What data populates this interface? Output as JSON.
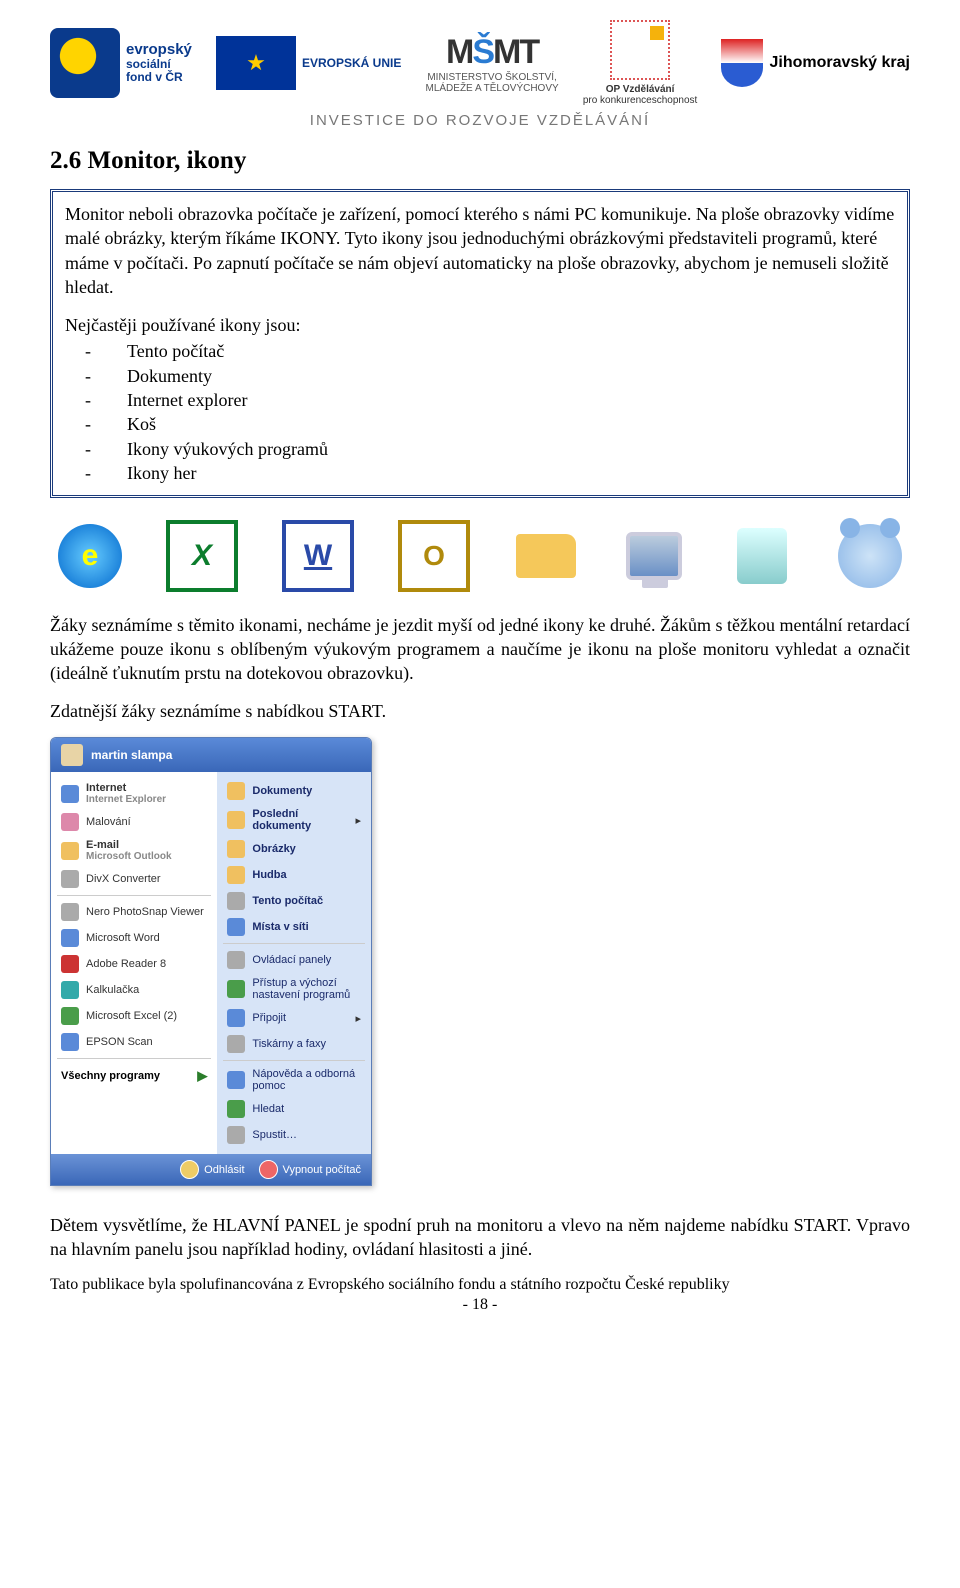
{
  "header": {
    "esf_line1": "evropský",
    "esf_line2": "sociální",
    "esf_line3": "fond v ČR",
    "eu_label": "EVROPSKÁ UNIE",
    "msmt_line1": "MINISTERSTVO ŠKOLSTVÍ,",
    "msmt_line2": "MLÁDEŽE A TĚLOVÝCHOVY",
    "opvz_line1": "OP Vzdělávání",
    "opvz_line2": "pro konkurenceschopnost",
    "jmk": "Jihomoravský kraj",
    "invest": "INVESTICE DO ROZVOJE VZDĚLÁVÁNÍ"
  },
  "title": "2.6 Monitor, ikony",
  "box": {
    "p1": "Monitor neboli obrazovka počítače je zařízení, pomocí kterého s námi PC komunikuje. Na ploše obrazovky vidíme malé obrázky, kterým říkáme IKONY. Tyto ikony jsou jednoduchými obrázkovými představiteli programů, které máme v počítači. Po zapnutí počítače se nám objeví automaticky na ploše obrazovky, abychom je nemuseli složitě hledat.",
    "list_intro": "Nejčastěji používané ikony jsou:",
    "items": [
      "Tento počítač",
      "Dokumenty",
      "Internet explorer",
      "Koš",
      "Ikony výukových programů",
      "Ikony her"
    ]
  },
  "icons_row": {
    "ie": "e",
    "excel": "X",
    "word": "W",
    "outlook": "O"
  },
  "body1": "Žáky seznámíme s těmito ikonami, necháme je jezdit myší od jedné ikony ke druhé. Žákům s těžkou mentální retardací ukážeme pouze ikonu s oblíbeným výukovým programem a naučíme je ikonu na ploše monitoru vyhledat a označit (ideálně ťuknutím prstu na dotekovou obrazovku).",
  "body2": "Zdatnější žáky seznámíme s nabídkou START.",
  "start_menu": {
    "user": "martin slampa",
    "left": [
      {
        "title": "Internet",
        "sub": "Internet Explorer",
        "icn": "blue"
      },
      {
        "title": "Malování",
        "icn": "pink"
      },
      {
        "title": "E-mail",
        "sub": "Microsoft Outlook",
        "icn": ""
      },
      {
        "title": "DivX Converter",
        "icn": "grey"
      },
      {
        "title": "Nero PhotoSnap Viewer",
        "icn": "grey"
      },
      {
        "title": "Microsoft Word",
        "icn": "blue"
      },
      {
        "title": "Adobe Reader 8",
        "icn": "red"
      },
      {
        "title": "Kalkulačka",
        "icn": "teal"
      },
      {
        "title": "Microsoft Excel (2)",
        "icn": "green"
      },
      {
        "title": "EPSON Scan",
        "icn": "blue"
      }
    ],
    "all_programs": "Všechny programy",
    "right": [
      {
        "title": "Dokumenty",
        "icn": "",
        "bold": true
      },
      {
        "title": "Poslední dokumenty",
        "icn": "",
        "bold": true,
        "arrow": true
      },
      {
        "title": "Obrázky",
        "icn": "",
        "bold": true
      },
      {
        "title": "Hudba",
        "icn": "",
        "bold": true
      },
      {
        "title": "Tento počítač",
        "icn": "grey",
        "bold": true
      },
      {
        "title": "Místa v síti",
        "icn": "blue",
        "bold": true
      },
      {
        "title": "Ovládací panely",
        "icn": "grey",
        "thin": true
      },
      {
        "title": "Přístup a výchozí nastavení programů",
        "icn": "green",
        "thin": true
      },
      {
        "title": "Připojit",
        "icn": "blue",
        "thin": true,
        "arrow": true
      },
      {
        "title": "Tiskárny a faxy",
        "icn": "grey",
        "thin": true
      },
      {
        "title": "Nápověda a odborná pomoc",
        "icn": "blue",
        "thin": true
      },
      {
        "title": "Hledat",
        "icn": "green",
        "thin": true
      },
      {
        "title": "Spustit…",
        "icn": "grey",
        "thin": true
      }
    ],
    "footer": {
      "logoff": "Odhlásit",
      "shutdown": "Vypnout počítač"
    }
  },
  "body3": "Dětem vysvětlíme, že HLAVNÍ PANEL je spodní pruh na monitoru a vlevo na něm najdeme nabídku START. Vpravo na hlavním panelu jsou například hodiny, ovládaní hlasitosti a jiné.",
  "publication": "Tato publikace byla spolufinancována z Evropského sociálního fondu a státního rozpočtu České republiky",
  "page_number": "- 18 -"
}
